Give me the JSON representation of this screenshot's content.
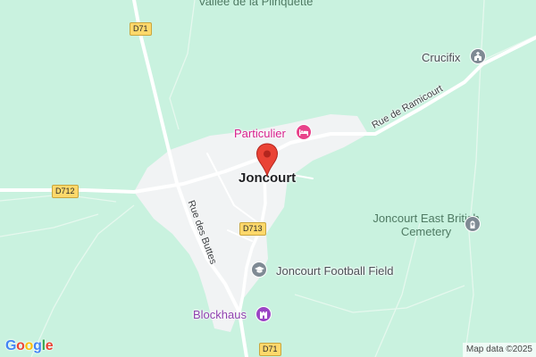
{
  "map": {
    "areas": {
      "vallee": "Vallée de la Plinquette",
      "east_cemetery": "Joncourt East British Cemetery"
    },
    "town": "Joncourt",
    "pois": {
      "particulier": "Particulier",
      "crucifix": "Crucifix",
      "football": "Joncourt Football Field",
      "blockhaus": "Blockhaus"
    },
    "roads": {
      "ramicourt": "Rue de Ramicourt",
      "buttes": "Rue des Buttes"
    },
    "shields": {
      "d71_top": "D71",
      "d712": "D712",
      "d713": "D713",
      "d71_bottom": "D71"
    },
    "icons": {
      "hotel": "bed-icon",
      "church": "church-icon",
      "cemetery": "cemetery-icon",
      "school": "graduation-cap-icon",
      "landmark": "castle-icon",
      "pin": "location-pin-icon"
    },
    "colors": {
      "land": "#c9f2df",
      "village": "#f1f3f4",
      "road": "#ffffff",
      "pin": "#ea4335",
      "hotel": "#e8428a",
      "landmark": "#9b45c5",
      "gray_poi": "#7f8a94"
    },
    "logo": "Google",
    "attribution": "Map data ©2025"
  }
}
